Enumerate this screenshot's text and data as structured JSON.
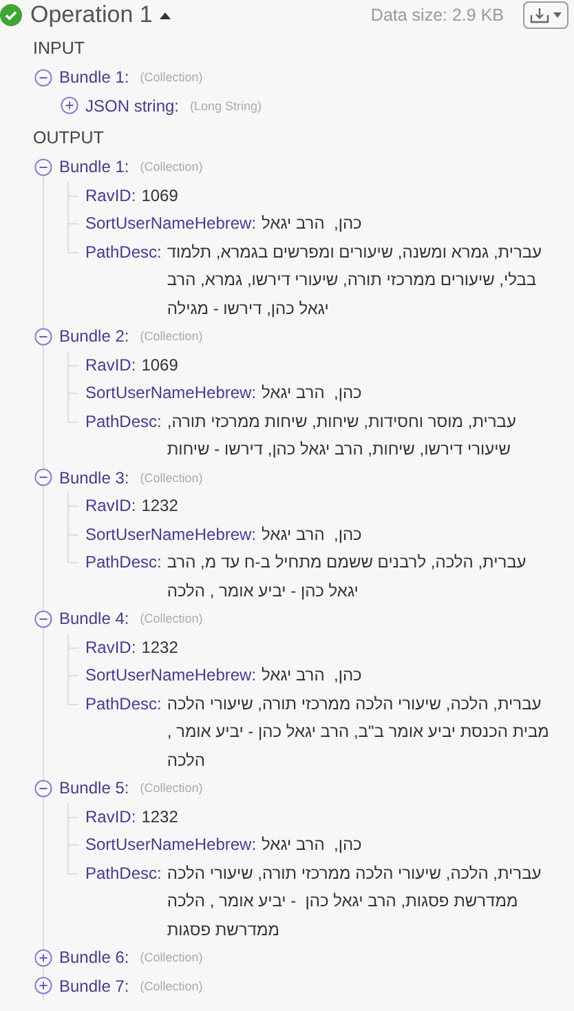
{
  "header": {
    "title": "Operation 1",
    "expanded": true,
    "data_size": "Data size: 2.9 KB"
  },
  "sections": [
    {
      "label": "INPUT",
      "bundles": [
        {
          "label": "Bundle 1:",
          "type": "(Collection)",
          "expanded": true,
          "fields": [
            {
              "kind": "collection",
              "key": "JSON string:",
              "type": "(Long String)",
              "expanded": false
            }
          ]
        }
      ]
    },
    {
      "label": "OUTPUT",
      "bundles": [
        {
          "label": "Bundle 1:",
          "type": "(Collection)",
          "expanded": true,
          "fields": [
            {
              "kind": "value",
              "key": "RavID:",
              "value": "1069"
            },
            {
              "kind": "value",
              "key": "SortUserNameHebrew:",
              "value": "כהן,  הרב יגאל"
            },
            {
              "kind": "value",
              "key": "PathDesc:",
              "value": "עברית, גמרא ומשנה, שיעורים ומפרשים בגמרא, תלמוד בבלי, שיעורים ממרכזי תורה, שיעורי דירשו, גמרא, הרב יגאל כהן, דירשו - מגילה"
            }
          ]
        },
        {
          "label": "Bundle 2:",
          "type": "(Collection)",
          "expanded": true,
          "fields": [
            {
              "kind": "value",
              "key": "RavID:",
              "value": "1069"
            },
            {
              "kind": "value",
              "key": "SortUserNameHebrew:",
              "value": "כהן,  הרב יגאל"
            },
            {
              "kind": "value",
              "key": "PathDesc:",
              "value": "עברית, מוסר וחסידות, שיחות, שיחות ממרכזי תורה, שיעורי דירשו, שיחות, הרב יגאל כהן, דירשו - שיחות"
            }
          ]
        },
        {
          "label": "Bundle 3:",
          "type": "(Collection)",
          "expanded": true,
          "fields": [
            {
              "kind": "value",
              "key": "RavID:",
              "value": "1232"
            },
            {
              "kind": "value",
              "key": "SortUserNameHebrew:",
              "value": "כהן,  הרב יגאל"
            },
            {
              "kind": "value",
              "key": "PathDesc:",
              "value": "עברית, הלכה, לרבנים ששמם מתחיל ב-ח עד מ, הרב יגאל כהן - יביע אומר , הלכה"
            }
          ]
        },
        {
          "label": "Bundle 4:",
          "type": "(Collection)",
          "expanded": true,
          "fields": [
            {
              "kind": "value",
              "key": "RavID:",
              "value": "1232"
            },
            {
              "kind": "value",
              "key": "SortUserNameHebrew:",
              "value": "כהן,  הרב יגאל"
            },
            {
              "kind": "value",
              "key": "PathDesc:",
              "value": "עברית, הלכה, שיעורי הלכה ממרכזי תורה, שיעורי הלכה מבית הכנסת יביע אומר ב\"ב, הרב יגאל כהן - יביע אומר , הלכה"
            }
          ]
        },
        {
          "label": "Bundle 5:",
          "type": "(Collection)",
          "expanded": true,
          "fields": [
            {
              "kind": "value",
              "key": "RavID:",
              "value": "1232"
            },
            {
              "kind": "value",
              "key": "SortUserNameHebrew:",
              "value": "כהן,  הרב יגאל"
            },
            {
              "kind": "value",
              "key": "PathDesc:",
              "value": "עברית, הלכה, שיעורי הלכה ממרכזי תורה, שיעורי הלכה ממדרשת פסגות, הרב יגאל כהן  - יביע אומר , הלכה ממדרשת פסגות"
            }
          ]
        },
        {
          "label": "Bundle 6:",
          "type": "(Collection)",
          "expanded": false
        },
        {
          "label": "Bundle 7:",
          "type": "(Collection)",
          "expanded": false
        }
      ]
    }
  ]
}
